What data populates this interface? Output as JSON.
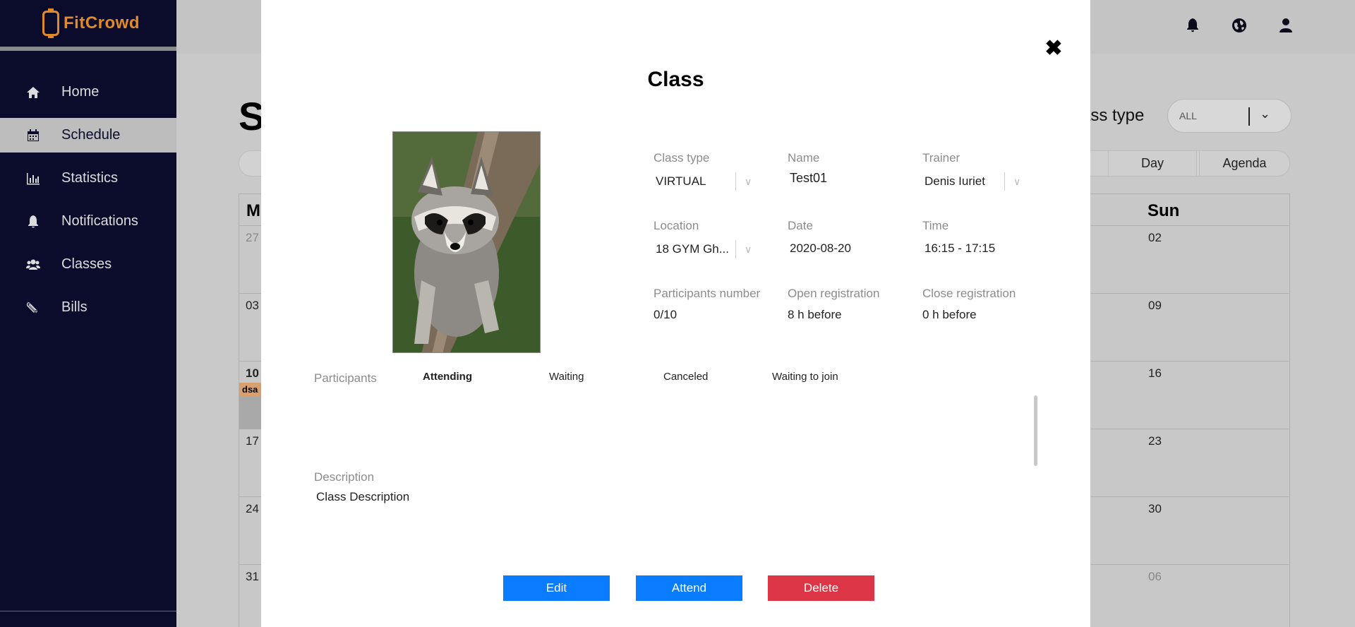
{
  "app": {
    "brand": "FitCrowd"
  },
  "sidebar": {
    "items": [
      {
        "label": "Home",
        "icon": "home-icon"
      },
      {
        "label": "Schedule",
        "icon": "calendar-icon",
        "active": true
      },
      {
        "label": "Statistics",
        "icon": "bar-chart-icon"
      },
      {
        "label": "Notifications",
        "icon": "bell-icon"
      },
      {
        "label": "Classes",
        "icon": "users-icon"
      },
      {
        "label": "Bills",
        "icon": "paperclip-icon"
      }
    ]
  },
  "topbar": {
    "icons": [
      "bell-icon",
      "globe-icon",
      "user-icon"
    ]
  },
  "background_page": {
    "title_partial": "S",
    "filter_label": "ass type",
    "filter_value": "ALL",
    "views": [
      "Day",
      "Agenda"
    ],
    "calendar": {
      "left_header": "M",
      "right_header": "Sun",
      "left_dates": [
        "27",
        "03",
        "10",
        "17",
        "24",
        "31"
      ],
      "right_dates": [
        "02",
        "09",
        "16",
        "23",
        "30",
        "06"
      ],
      "event_chip": "dsa"
    }
  },
  "modal": {
    "title": "Class",
    "fields": {
      "class_type": {
        "label": "Class type",
        "value": "VIRTUAL"
      },
      "name": {
        "label": "Name",
        "value": "Test01"
      },
      "trainer": {
        "label": "Trainer",
        "value": "Denis Iuriet"
      },
      "location": {
        "label": "Location",
        "value": "18 GYM Gh..."
      },
      "date": {
        "label": "Date",
        "value": "2020-08-20"
      },
      "time": {
        "label": "Time",
        "value": "16:15 - 17:15"
      },
      "participants_number": {
        "label": "Participants number",
        "value": "0/10"
      },
      "open_registration": {
        "label": "Open registration",
        "value": "8 h before"
      },
      "close_registration": {
        "label": "Close registration",
        "value": "0 h before"
      }
    },
    "participants": {
      "label": "Participants",
      "tabs": [
        "Attending",
        "Waiting",
        "Canceled",
        "Waiting to join"
      ],
      "active_tab": "Attending"
    },
    "description": {
      "label": "Description",
      "value": "Class Description"
    },
    "buttons": {
      "edit": "Edit",
      "attend": "Attend",
      "delete": "Delete"
    }
  },
  "colors": {
    "sidebar_bg": "#0b0b2b",
    "brand_orange": "#e08a2c",
    "primary_blue": "#0a7cff",
    "danger_red": "#dc3545"
  }
}
